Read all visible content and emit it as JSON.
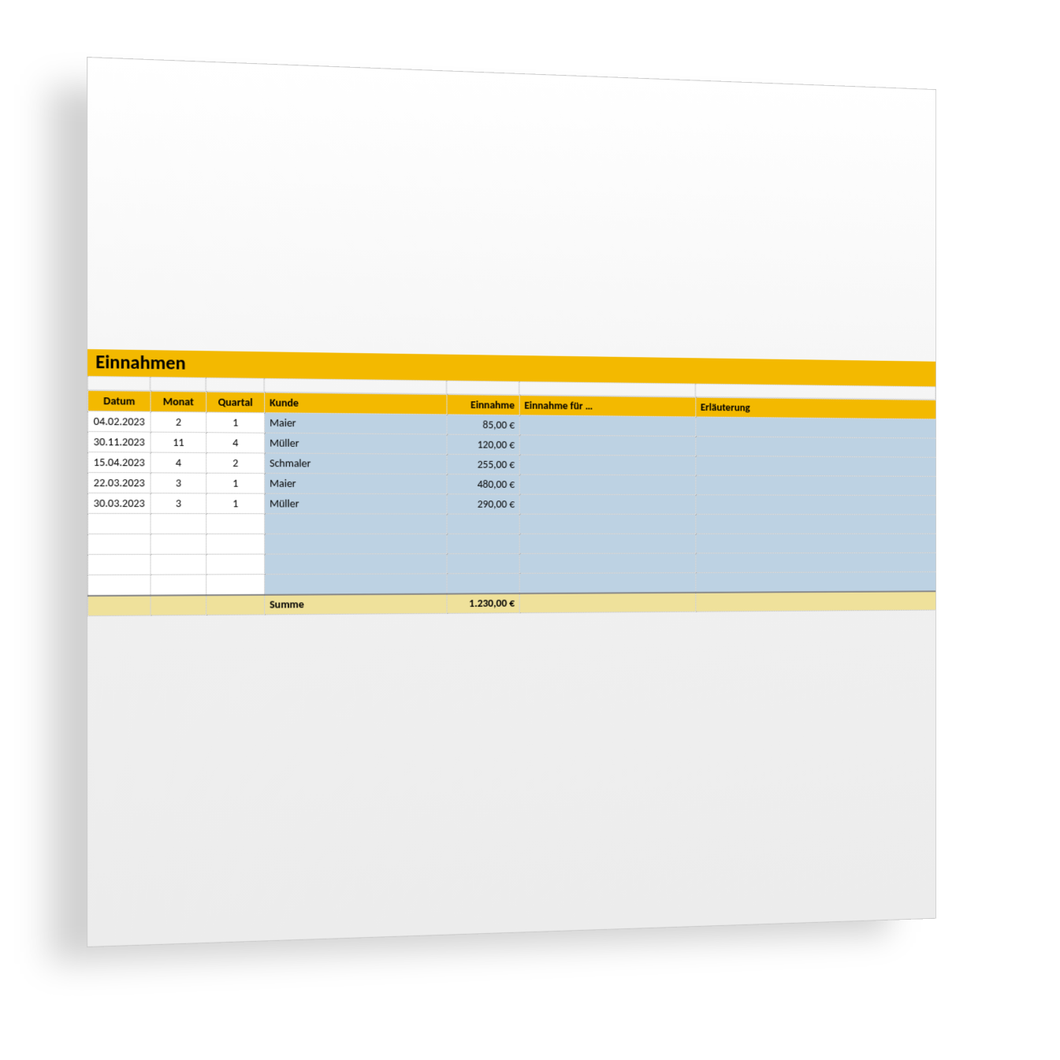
{
  "title": "Einnahmen",
  "columns": {
    "datum": "Datum",
    "monat": "Monat",
    "quartal": "Quartal",
    "kunde": "Kunde",
    "einnahme": "Einnahme",
    "einnahme_fuer": "Einnahme für …",
    "erlaeuterung": "Erläuterung"
  },
  "rows": [
    {
      "datum": "04.02.2023",
      "monat": "2",
      "quartal": "1",
      "kunde": "Maier",
      "einnahme": "85,00 €",
      "einnahme_fuer": "",
      "erlaeuterung": ""
    },
    {
      "datum": "30.11.2023",
      "monat": "11",
      "quartal": "4",
      "kunde": "Müller",
      "einnahme": "120,00 €",
      "einnahme_fuer": "",
      "erlaeuterung": ""
    },
    {
      "datum": "15.04.2023",
      "monat": "4",
      "quartal": "2",
      "kunde": "Schmaler",
      "einnahme": "255,00 €",
      "einnahme_fuer": "",
      "erlaeuterung": ""
    },
    {
      "datum": "22.03.2023",
      "monat": "3",
      "quartal": "1",
      "kunde": "Maier",
      "einnahme": "480,00 €",
      "einnahme_fuer": "",
      "erlaeuterung": ""
    },
    {
      "datum": "30.03.2023",
      "monat": "3",
      "quartal": "1",
      "kunde": "Müller",
      "einnahme": "290,00 €",
      "einnahme_fuer": "",
      "erlaeuterung": ""
    },
    {
      "datum": "",
      "monat": "",
      "quartal": "",
      "kunde": "",
      "einnahme": "",
      "einnahme_fuer": "",
      "erlaeuterung": ""
    },
    {
      "datum": "",
      "monat": "",
      "quartal": "",
      "kunde": "",
      "einnahme": "",
      "einnahme_fuer": "",
      "erlaeuterung": ""
    },
    {
      "datum": "",
      "monat": "",
      "quartal": "",
      "kunde": "",
      "einnahme": "",
      "einnahme_fuer": "",
      "erlaeuterung": ""
    },
    {
      "datum": "",
      "monat": "",
      "quartal": "",
      "kunde": "",
      "einnahme": "",
      "einnahme_fuer": "",
      "erlaeuterung": ""
    }
  ],
  "summary": {
    "label": "Summe",
    "amount": "1.230,00 €"
  }
}
